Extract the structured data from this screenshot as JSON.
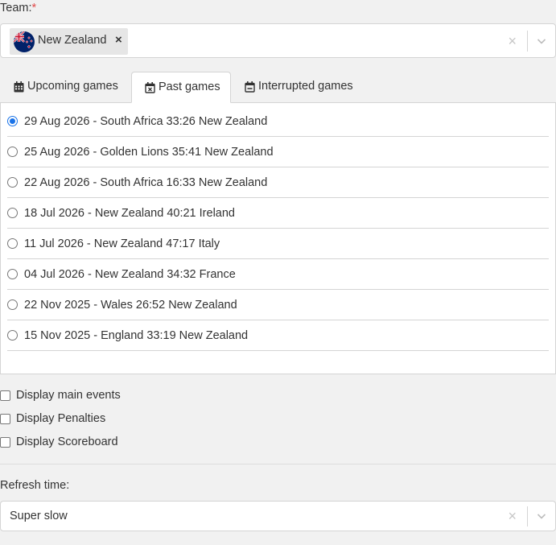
{
  "team_field": {
    "label": "Team:",
    "required_mark": "*",
    "selected": [
      {
        "label": "New Zealand",
        "flag_icon": "new-zealand-flag-icon",
        "remove_glyph": "×"
      }
    ],
    "clear_glyph": "×"
  },
  "tabs": [
    {
      "label": "Upcoming games",
      "icon": "calendar-icon",
      "active": false
    },
    {
      "label": "Past games",
      "icon": "calendar-x-icon",
      "active": true
    },
    {
      "label": "Interrupted games",
      "icon": "calendar-minus-icon",
      "active": false
    }
  ],
  "games": [
    {
      "label": "29 Aug 2026 - South Africa 33:26 New Zealand",
      "checked": true
    },
    {
      "label": "25 Aug 2026 - Golden Lions 35:41 New Zealand",
      "checked": false
    },
    {
      "label": "22 Aug 2026 - South Africa 16:33 New Zealand",
      "checked": false
    },
    {
      "label": "18 Jul 2026 - New Zealand 40:21 Ireland",
      "checked": false
    },
    {
      "label": "11 Jul 2026 - New Zealand 47:17 Italy",
      "checked": false
    },
    {
      "label": "04 Jul 2026 - New Zealand 34:32 France",
      "checked": false
    },
    {
      "label": "22 Nov 2025 - Wales 26:52 New Zealand",
      "checked": false
    },
    {
      "label": "15 Nov 2025 - England 33:19 New Zealand",
      "checked": false
    }
  ],
  "options": [
    {
      "label": "Display main events",
      "checked": false
    },
    {
      "label": "Display Penalties",
      "checked": false
    },
    {
      "label": "Display Scoreboard",
      "checked": false
    }
  ],
  "refresh_field": {
    "label": "Refresh time:",
    "value": "Super slow",
    "clear_glyph": "×"
  },
  "colors": {
    "accent": "#1a73e8",
    "required": "#e14b4b",
    "background": "#f1f1f1",
    "border": "#d4d4d4"
  }
}
